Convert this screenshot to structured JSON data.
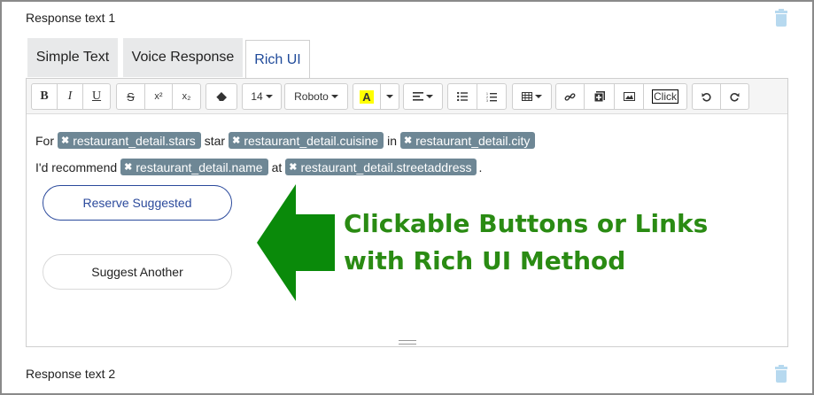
{
  "section1": {
    "label": "Response text 1"
  },
  "section2": {
    "label": "Response text 2"
  },
  "tabs": [
    {
      "label": "Simple Text",
      "active": false
    },
    {
      "label": "Voice Response",
      "active": false
    },
    {
      "label": "Rich UI",
      "active": true
    }
  ],
  "toolbar": {
    "bold": "B",
    "italic": "I",
    "underline": "U",
    "strike": "S",
    "superscript": "x²",
    "subscript": "x₂",
    "font_size": "14",
    "font_family": "Roboto",
    "highlight": "A",
    "click_label": "Click"
  },
  "content": {
    "line1": {
      "t1": "For",
      "c1": "restaurant_detail.stars",
      "t2": "star",
      "c2": "restaurant_detail.cuisine",
      "t3": "in",
      "c3": "restaurant_detail.city"
    },
    "line2": {
      "t1": "I'd recommend",
      "c1": "restaurant_detail.name",
      "t2": "at",
      "c2": "restaurant_detail.streetaddress",
      "t3": "."
    },
    "button1": "Reserve Suggested",
    "button2": "Suggest Another"
  },
  "callout": {
    "line1": "Clickable Buttons or Links",
    "line2": "with Rich UI Method"
  },
  "colors": {
    "accent": "#1f4a9a",
    "chip": "#6e8795",
    "callout": "#2a8b13",
    "trash": "#b7d9ef"
  }
}
